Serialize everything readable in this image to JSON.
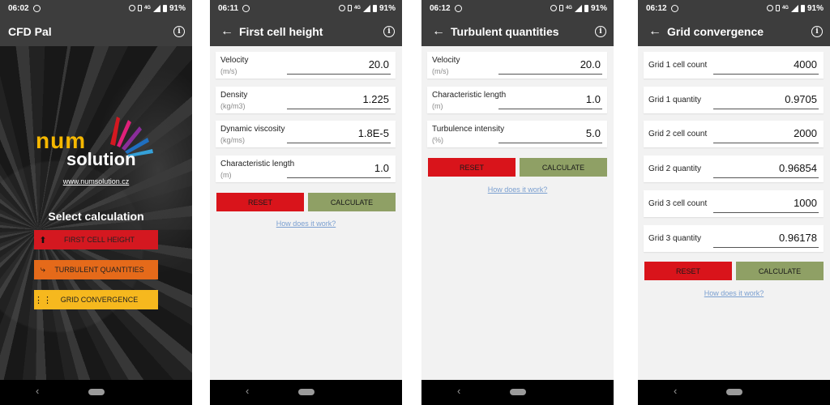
{
  "status_icons": {
    "alarm": "alarm-icon",
    "vibrate": "vibrate-icon",
    "network": "4G",
    "signal": "signal-icon",
    "battery": "battery-icon"
  },
  "colors": {
    "bar": "#3d3d3d",
    "reset": "#d9141b",
    "calculate": "#8fa065",
    "menu_red": "#d41820",
    "menu_orange": "#e56a1a",
    "menu_yellow": "#f6b81e",
    "link": "#7a9fd0"
  },
  "screen1": {
    "time": "06:02",
    "battery": "91%",
    "title": "CFD Pal",
    "logo_num": "num",
    "logo_solution": "solution",
    "website": "www.numsolution.cz",
    "select_title": "Select calculation",
    "menu": [
      {
        "label": "FIRST CELL HEIGHT",
        "icon": "arrow-up-icon"
      },
      {
        "label": "TURBULENT QUANTITIES",
        "icon": "swirl-arrow-icon"
      },
      {
        "label": "GRID CONVERGENCE",
        "icon": "grid-dots-icon"
      }
    ]
  },
  "screen2": {
    "time": "06:11",
    "battery": "91%",
    "title": "First cell height",
    "fields": [
      {
        "label": "Velocity",
        "unit": "(m/s)",
        "value": "20.0"
      },
      {
        "label": "Density",
        "unit": "(kg/m3)",
        "value": "1.225"
      },
      {
        "label": "Dynamic viscosity",
        "unit": "(kg/ms)",
        "value": "1.8E-5"
      },
      {
        "label": "Characteristic length",
        "unit": "(m)",
        "value": "1.0"
      }
    ],
    "reset": "RESET",
    "calculate": "CALCULATE",
    "link": "How does it work?"
  },
  "screen3": {
    "time": "06:12",
    "battery": "91%",
    "title": "Turbulent quantities",
    "fields": [
      {
        "label": "Velocity",
        "unit": "(m/s)",
        "value": "20.0"
      },
      {
        "label": "Characteristic length",
        "unit": "(m)",
        "value": "1.0"
      },
      {
        "label": "Turbulence intensity",
        "unit": "(%)",
        "value": "5.0"
      }
    ],
    "reset": "RESET",
    "calculate": "CALCULATE",
    "link": "How does it work?"
  },
  "screen4": {
    "time": "06:12",
    "battery": "91%",
    "title": "Grid convergence",
    "fields": [
      {
        "label": "Grid 1 cell count",
        "value": "4000"
      },
      {
        "label": "Grid 1 quantity",
        "value": "0.9705"
      },
      {
        "label": "Grid 2 cell count",
        "value": "2000"
      },
      {
        "label": "Grid 2 quantity",
        "value": "0.96854"
      },
      {
        "label": "Grid 3 cell count",
        "value": "1000"
      },
      {
        "label": "Grid 3 quantity",
        "value": "0.96178"
      }
    ],
    "reset": "RESET",
    "calculate": "CALCULATE",
    "link": "How does it work?"
  }
}
